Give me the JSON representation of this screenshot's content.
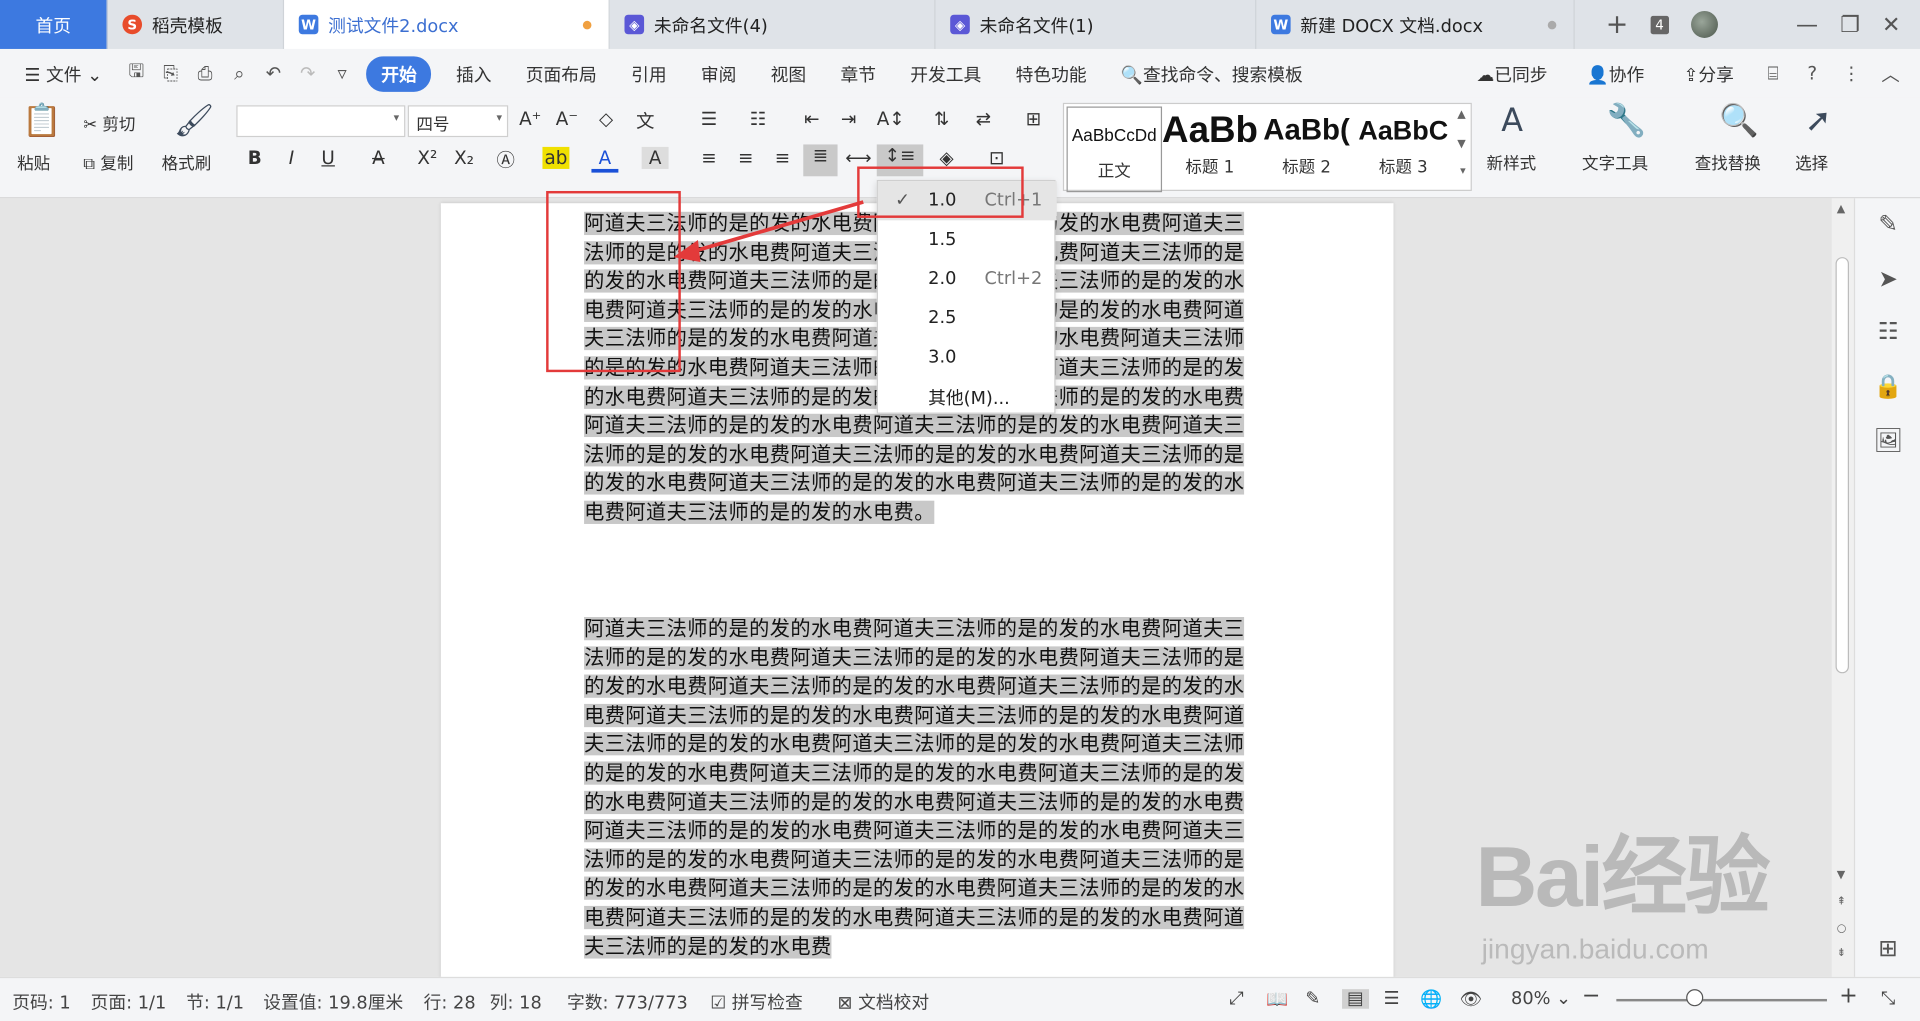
{
  "tabs": [
    {
      "label": "首页",
      "icon": "home"
    },
    {
      "label": "稻壳模板",
      "icon": "docer-icon"
    },
    {
      "label": "测试文件2.docx",
      "icon": "word-doc-icon",
      "modified": true
    },
    {
      "label": "未命名文件(4)",
      "icon": "flow-file-icon"
    },
    {
      "label": "未命名文件(1)",
      "icon": "flow-file-icon"
    },
    {
      "label": "新建 DOCX 文档.docx",
      "icon": "word-doc-icon"
    }
  ],
  "tabbar": {
    "add": "+",
    "window_count": "4"
  },
  "menu": {
    "file": "文件",
    "tabs": [
      "开始",
      "插入",
      "页面布局",
      "引用",
      "审阅",
      "视图",
      "章节",
      "开发工具",
      "特色功能"
    ],
    "search": "查找命令、搜索模板",
    "sync": "已同步",
    "collab": "协作",
    "share": "分享"
  },
  "ribbon": {
    "paste": "粘贴",
    "cut": "剪切",
    "copy": "复制",
    "format_painter": "格式刷",
    "font_name": "",
    "font_size": "四号",
    "styles": [
      {
        "preview": "AaBbCcDd",
        "name": "正文"
      },
      {
        "preview": "AaBb",
        "name": "标题 1"
      },
      {
        "preview": "AaBb(",
        "name": "标题 2"
      },
      {
        "preview": "AaBbC",
        "name": "标题 3"
      }
    ],
    "new_style": "新样式",
    "text_tools": "文字工具",
    "find_replace": "查找替换",
    "select": "选择"
  },
  "line_spacing_menu": [
    {
      "label": "1.0",
      "shortcut": "Ctrl+1",
      "checked": true
    },
    {
      "label": "1.5",
      "shortcut": "",
      "checked": false
    },
    {
      "label": "2.0",
      "shortcut": "Ctrl+2",
      "checked": false
    },
    {
      "label": "2.5",
      "shortcut": "",
      "checked": false
    },
    {
      "label": "3.0",
      "shortcut": "",
      "checked": false
    },
    {
      "label": "其他(M)...",
      "shortcut": "",
      "checked": false
    }
  ],
  "document": {
    "paragraph1": "阿道夫三法师的是的发的水电费阿道夫三法师的是的发的水电费阿道夫三法师的是的发的水电费阿道夫三法师的是的发的水电费阿道夫三法师的是的发的水电费阿道夫三法师的是的发的水电费阿道夫三法师的是的发的水电费阿道夫三法师的是的发的水电费阿道夫三法师的是的发的水电费阿道夫三法师的是的发的水电费阿道夫三法师的是的发的水电费阿道夫三法师的是的发的水电费阿道夫三法师的是的发的水电费阿道夫三法师的是的发的水电费阿道夫三法师的是的发的水电费阿道夫三法师的是的发的水电费阿道夫三法师的是的发的水电费阿道夫三法师的是的发的水电费阿道夫三法师的是的发的水电费阿道夫三法师的是的发的水电费阿道夫三法师的是的发的水电费阿道夫三法师的是的发的水电费阿道夫三法师的是的发的水电费阿道夫三法师的是的发的水电费。",
    "paragraph2": "阿道夫三法师的是的发的水电费阿道夫三法师的是的发的水电费阿道夫三法师的是的发的水电费阿道夫三法师的是的发的水电费阿道夫三法师的是的发的水电费阿道夫三法师的是的发的水电费阿道夫三法师的是的发的水电费阿道夫三法师的是的发的水电费阿道夫三法师的是的发的水电费阿道夫三法师的是的发的水电费阿道夫三法师的是的发的水电费阿道夫三法师的是的发的水电费阿道夫三法师的是的发的水电费阿道夫三法师的是的发的水电费阿道夫三法师的是的发的水电费阿道夫三法师的是的发的水电费阿道夫三法师的是的发的水电费阿道夫三法师的是的发的水电费阿道夫三法师的是的发的水电费阿道夫三法师的是的发的水电费阿道夫三法师的是的发的水电费阿道夫三法师的是的发的水电费阿道夫三法师的是的发的水电费阿道夫三法师的是的发的水电费阿道夫三法师的是的发的水电费阿道夫三法师的是的发的水电费"
  },
  "status": {
    "page_code": "页码: 1",
    "pages": "页面: 1/1",
    "section": "节: 1/1",
    "setting": "设置值: 19.8厘米",
    "row": "行: 28",
    "col": "列: 18",
    "words": "字数: 773/773",
    "spell": "拼写检查",
    "proof": "文档校对",
    "zoom": "80%"
  },
  "watermark": {
    "brand": "Bai经验",
    "url": "jingyan.baidu.com"
  },
  "colors": {
    "accent": "#3d79e0",
    "highlight_red": "#e33a3a",
    "selection": "#c8c8c8"
  }
}
